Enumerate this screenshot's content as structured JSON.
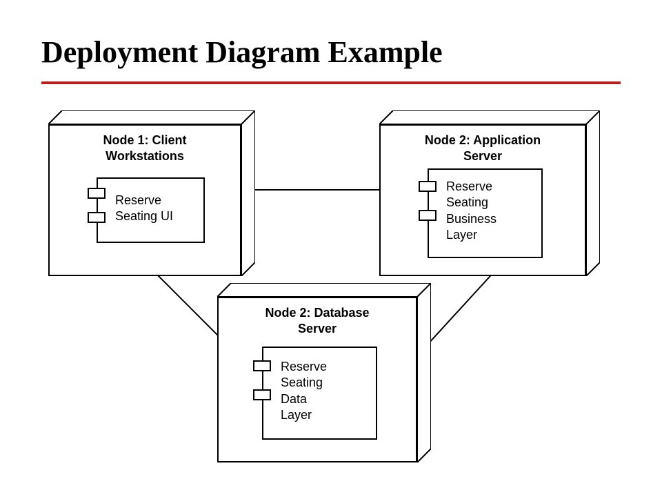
{
  "title": "Deployment Diagram Example",
  "nodes": {
    "client": {
      "title_line1": "Node 1:  Client",
      "title_line2": "Workstations",
      "component_label": "Reserve\nSeating UI"
    },
    "app": {
      "title_line1": "Node 2:  Application",
      "title_line2": "Server",
      "component_label": "Reserve\nSeating\nBusiness\nLayer"
    },
    "db": {
      "title_line1": "Node 2:  Database",
      "title_line2": "Server",
      "component_label": "Reserve\nSeating\nData\nLayer"
    }
  }
}
